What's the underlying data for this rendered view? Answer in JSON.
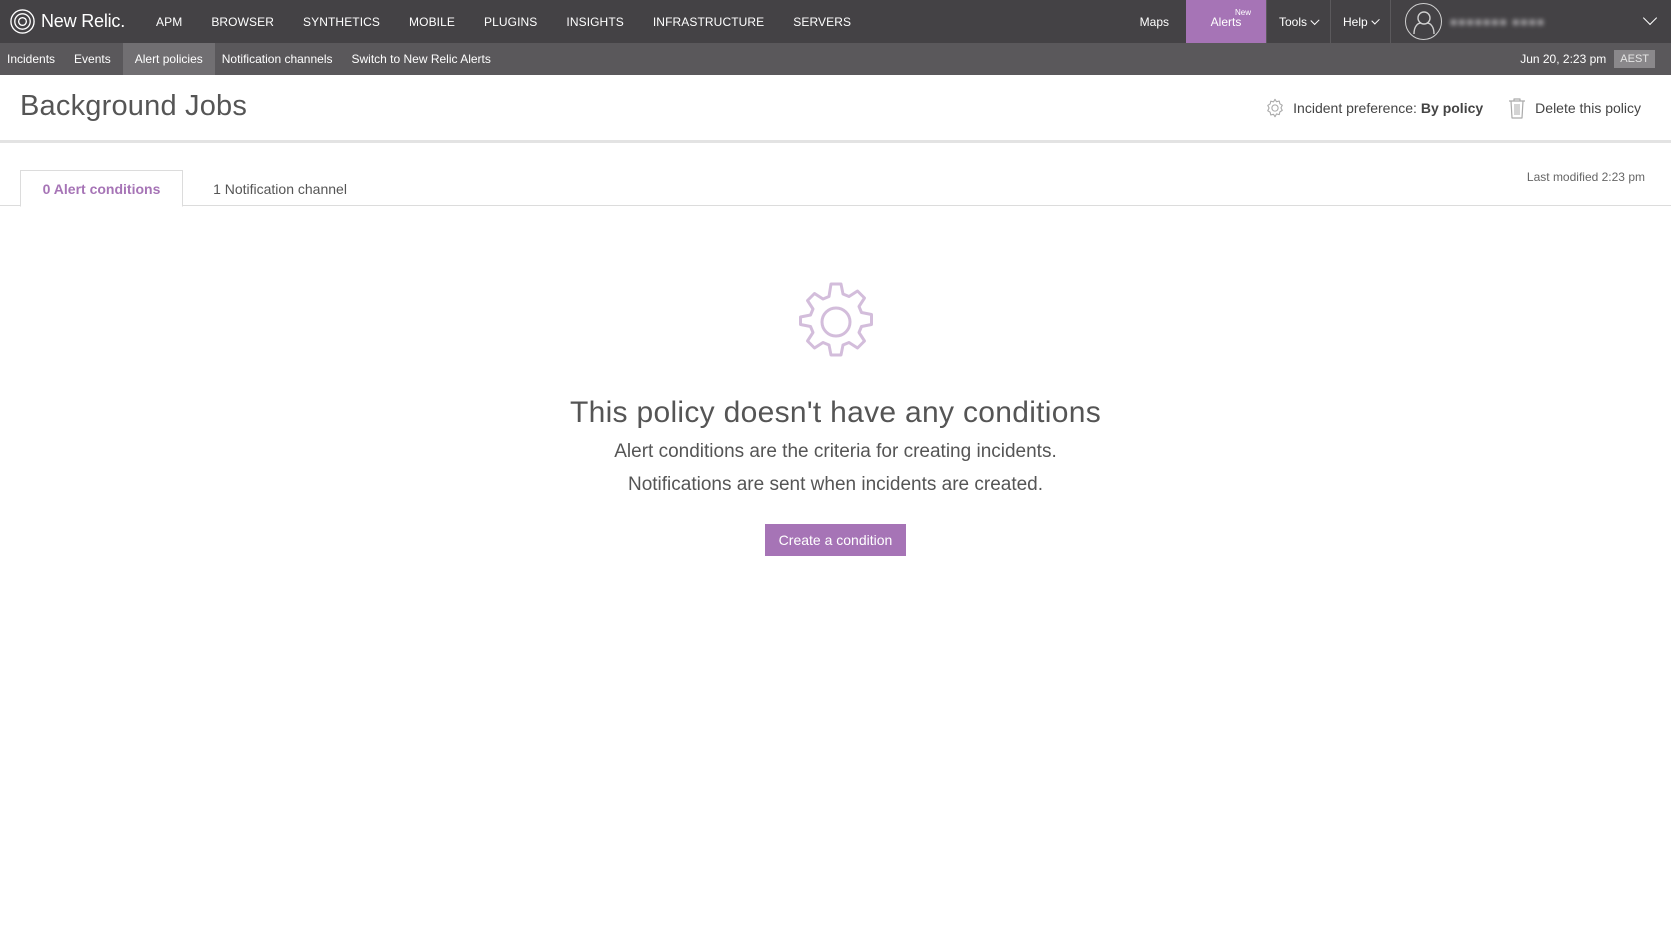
{
  "brand": {
    "name": "New Relic."
  },
  "topnav": {
    "items": [
      "APM",
      "BROWSER",
      "SYNTHETICS",
      "MOBILE",
      "PLUGINS",
      "INSIGHTS",
      "INFRASTRUCTURE",
      "SERVERS"
    ],
    "maps": "Maps",
    "alerts": "Alerts",
    "alerts_badge": "New",
    "tools": "Tools",
    "help": "Help",
    "username": "■■■■■■■ ■■■■"
  },
  "subnav": {
    "items": [
      "Incidents",
      "Events",
      "Alert policies",
      "Notification channels",
      "Switch to New Relic Alerts"
    ],
    "active": "Alert policies",
    "date": "Jun 20, 2:23 pm",
    "timezone": "AEST"
  },
  "header": {
    "title": "Background Jobs",
    "pref_label": "Incident preference:",
    "pref_value": "By policy",
    "delete_label": "Delete this policy"
  },
  "tabs": {
    "conditions": "0 Alert conditions",
    "channels": "1 Notification channel",
    "last_modified": "Last modified 2:23 pm"
  },
  "empty_state": {
    "title": "This policy doesn't have any conditions",
    "line1": "Alert conditions are the criteria for creating incidents.",
    "line2": "Notifications are sent when incidents are created.",
    "button": "Create a condition"
  },
  "colors": {
    "accent": "#a674b6",
    "topnav_bg": "#444245",
    "subnav_bg": "#5a585b"
  }
}
